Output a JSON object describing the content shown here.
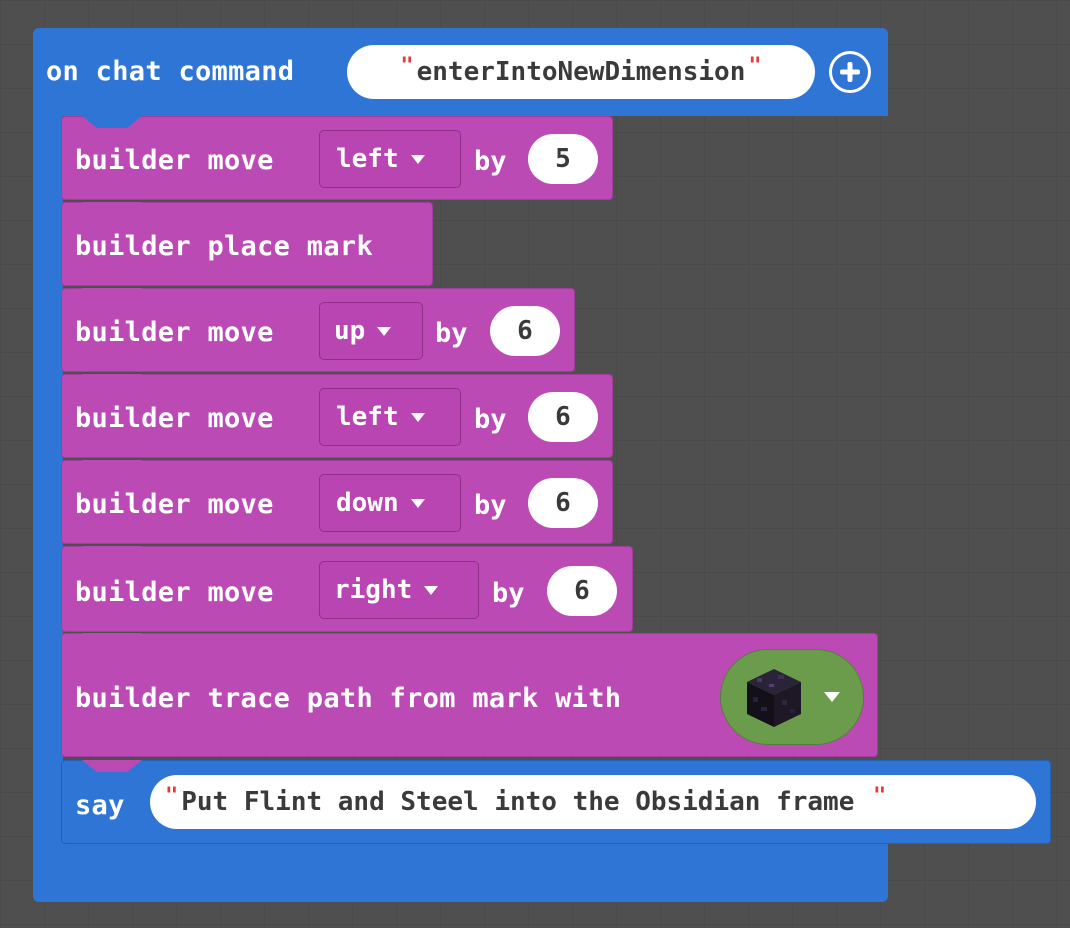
{
  "event": {
    "label": "on chat command",
    "command": "enterIntoNewDimension"
  },
  "blocks": [
    {
      "kind": "move",
      "label": "builder move",
      "direction": "left",
      "by": "by",
      "amount": "5"
    },
    {
      "kind": "mark",
      "label": "builder place mark"
    },
    {
      "kind": "move",
      "label": "builder move",
      "direction": "up",
      "by": "by",
      "amount": "6"
    },
    {
      "kind": "move",
      "label": "builder move",
      "direction": "left",
      "by": "by",
      "amount": "6"
    },
    {
      "kind": "move",
      "label": "builder move",
      "direction": "down",
      "by": "by",
      "amount": "6"
    },
    {
      "kind": "move",
      "label": "builder move",
      "direction": "right",
      "by": "by",
      "amount": "6"
    },
    {
      "kind": "trace",
      "label": "builder trace path from mark with",
      "block_icon": "obsidian-block-icon"
    }
  ],
  "say": {
    "label": "say",
    "text": "Put Flint and Steel into the Obsidian frame "
  },
  "colors": {
    "event_blue": "#2f75d6",
    "builder_magenta": "#bb4ab5",
    "picker_green": "#6a9c4c",
    "background": "#4f4f4f"
  }
}
